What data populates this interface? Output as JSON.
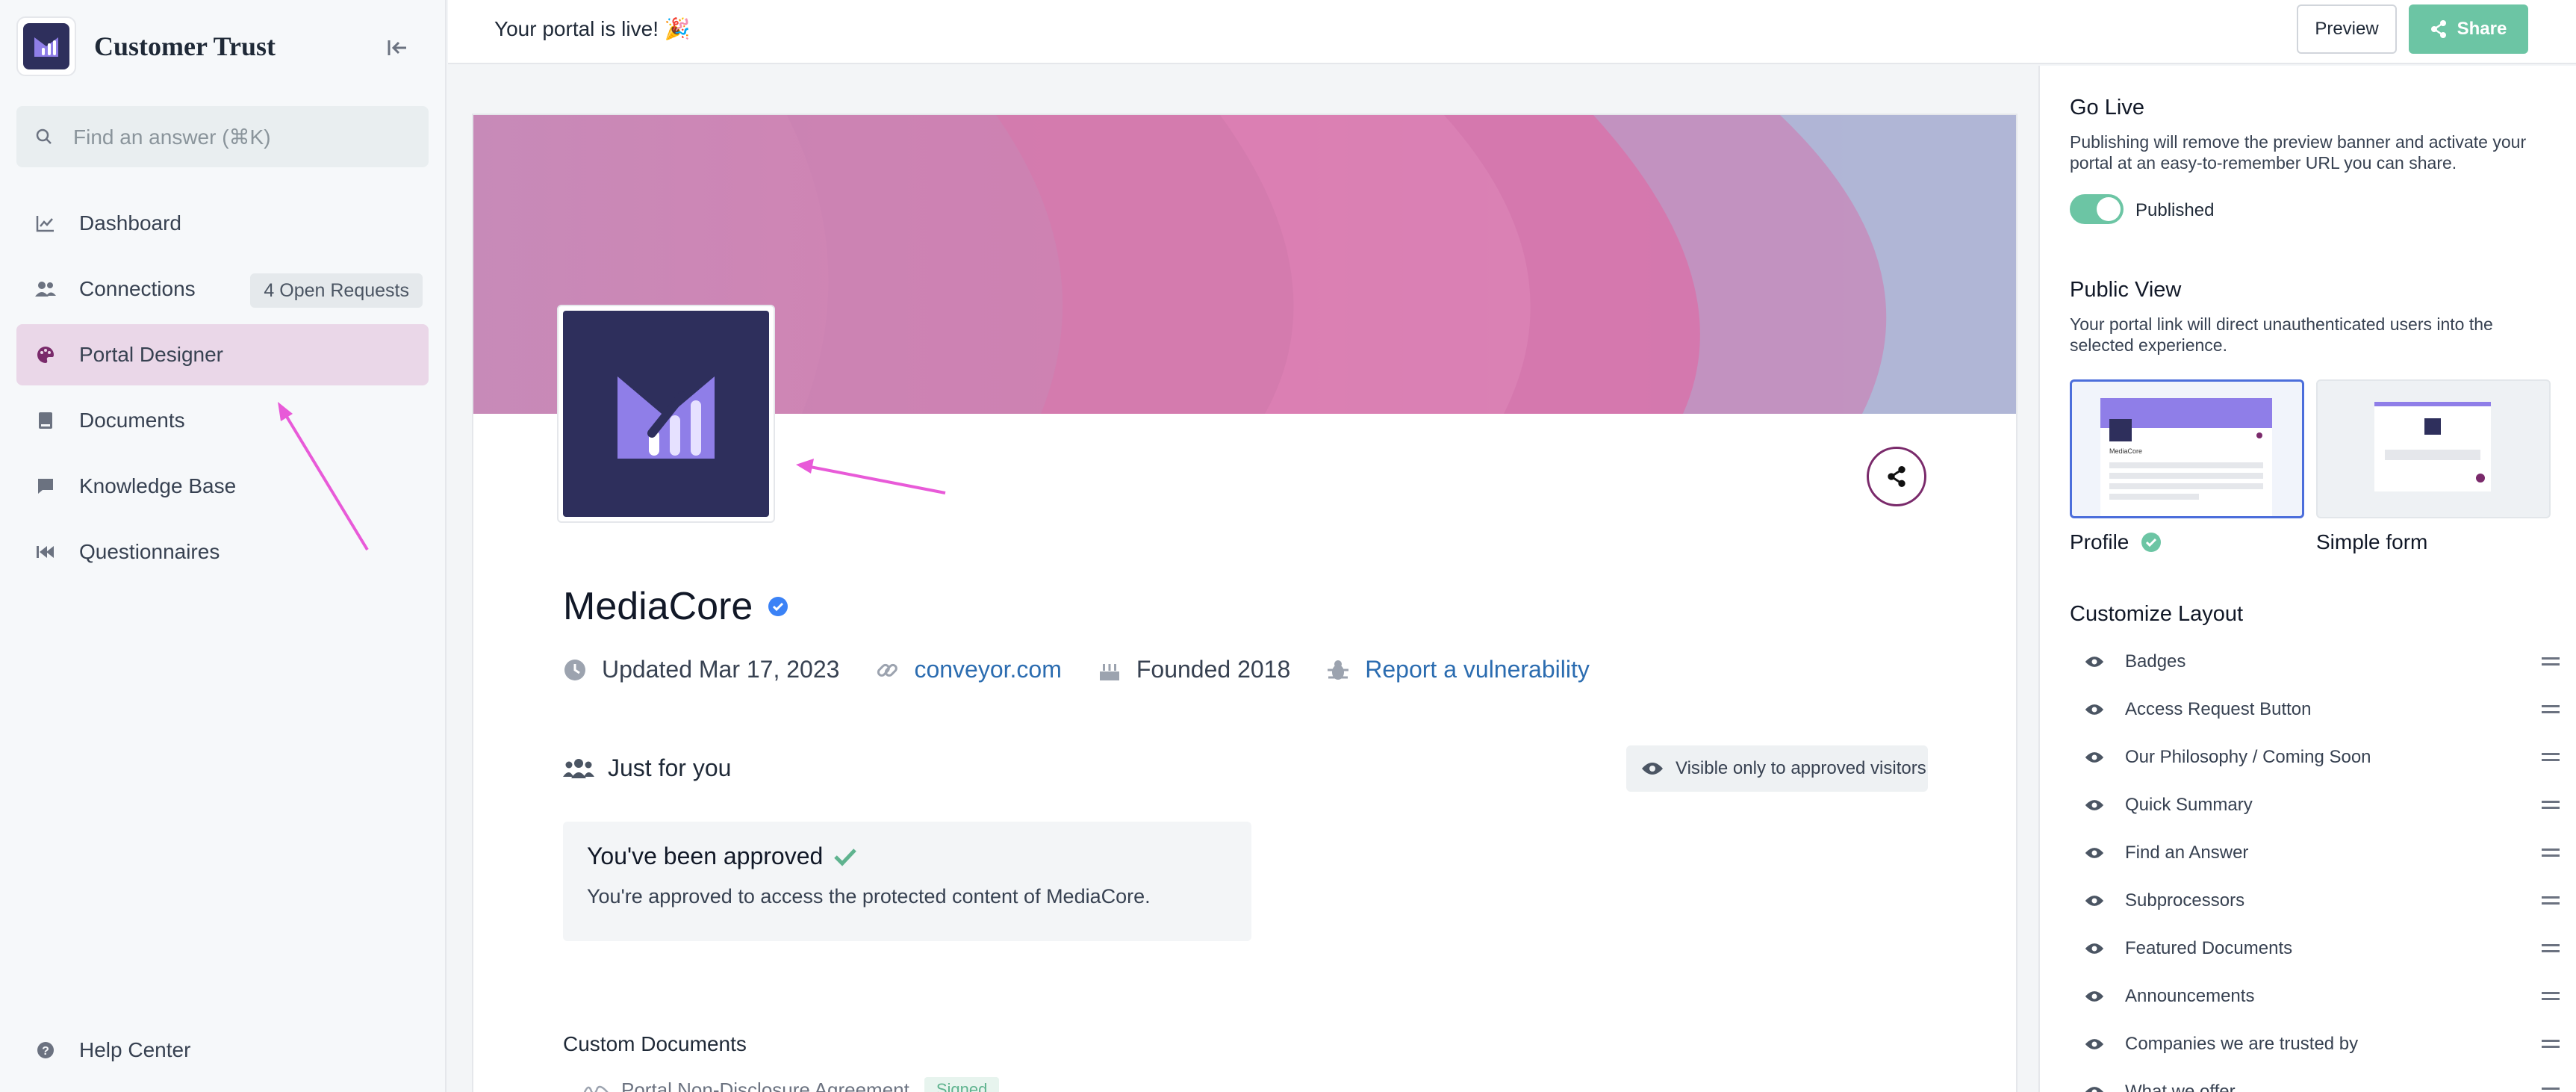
{
  "sidebar": {
    "brand_title": "Customer Trust",
    "search_placeholder": "Find an answer (⌘K)",
    "items": [
      {
        "label": "Dashboard",
        "icon": "chart-line-icon"
      },
      {
        "label": "Connections",
        "icon": "users-icon",
        "badge": "4 Open Requests"
      },
      {
        "label": "Portal Designer",
        "icon": "palette-icon",
        "active": true
      },
      {
        "label": "Documents",
        "icon": "book-icon"
      },
      {
        "label": "Knowledge Base",
        "icon": "chat-icon"
      },
      {
        "label": "Questionnaires",
        "icon": "fast-forward-icon"
      }
    ],
    "help_label": "Help Center"
  },
  "topbar": {
    "message": "Your portal is live! 🎉",
    "preview_label": "Preview",
    "share_label": "Share"
  },
  "profile": {
    "company_name": "MediaCore",
    "updated": "Updated Mar 17, 2023",
    "website": "conveyor.com",
    "founded": "Founded 2018",
    "report_link": "Report a vulnerability",
    "just_for_you": "Just for you",
    "visible_chip": "Visible only to approved visitors",
    "approved_title": "You've been approved",
    "approved_text": "You're approved to access the protected content of MediaCore.",
    "custom_documents": "Custom Documents",
    "nda_label": "Portal Non-Disclosure Agreement",
    "nda_status": "Signed"
  },
  "panel": {
    "go_live_title": "Go Live",
    "go_live_text": "Publishing will remove the preview banner and activate your portal at an easy-to-remember URL you can share.",
    "published_label": "Published",
    "public_view_title": "Public View",
    "public_view_text": "Your portal link will direct unauthenticated users into the selected experience.",
    "view_profile": "Profile",
    "view_simple": "Simple form",
    "mini_company": "MediaCore",
    "customize_title": "Customize Layout",
    "layout_items": [
      "Badges",
      "Access Request Button",
      "Our Philosophy / Coming Soon",
      "Quick Summary",
      "Find an Answer",
      "Subprocessors",
      "Featured Documents",
      "Announcements",
      "Companies we are trusted by",
      "What we offer"
    ]
  },
  "colors": {
    "accent_green": "#6cc5a4",
    "active_nav": "#ead7e8",
    "link_blue": "#2b6cb0",
    "logo_navy": "#2e2f5c",
    "annotation_arrow": "#e85ad8"
  }
}
